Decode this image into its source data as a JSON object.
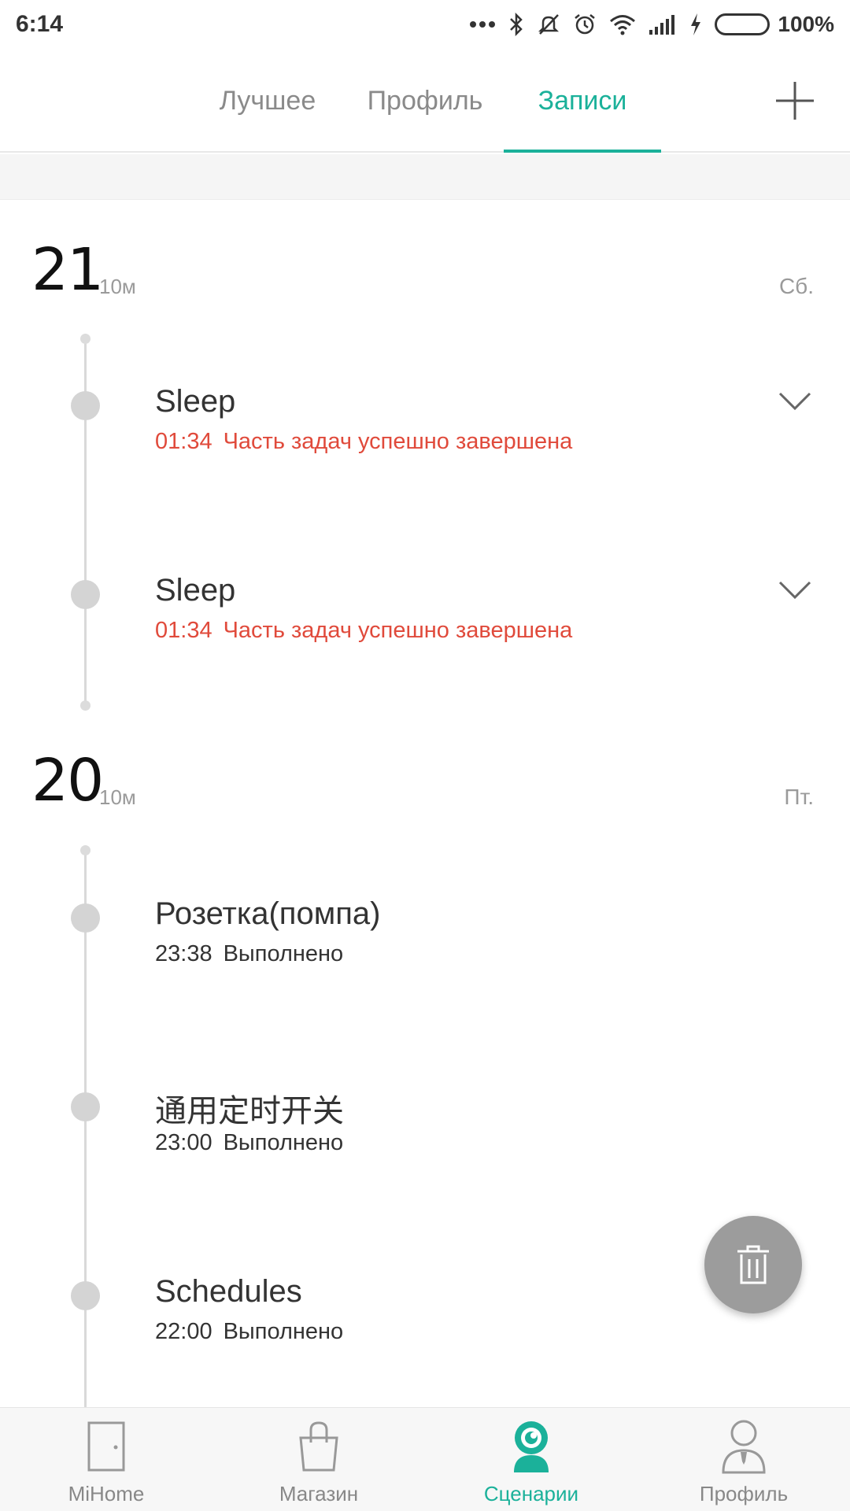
{
  "status_bar": {
    "time": "6:14",
    "battery_percent": "100%",
    "icons": [
      "more-dots-icon",
      "bluetooth-icon",
      "mute-icon",
      "alarm-icon",
      "wifi-icon",
      "signal-icon",
      "charging-icon",
      "battery-icon"
    ]
  },
  "tabs": {
    "items": [
      "Лучшее",
      "Профиль",
      "Записи"
    ],
    "active": "Записи",
    "add_icon": "plus-icon"
  },
  "colors": {
    "accent": "#1bb19a",
    "error": "#e04a3b",
    "fab": "#9c9c9c",
    "battery": "#2bbd2b"
  },
  "days": [
    {
      "day": "21",
      "month": "10м",
      "weekday": "Сб.",
      "entries": [
        {
          "title": "Sleep",
          "time": "01:34",
          "status": "Часть задач успешно завершена",
          "status_type": "partial",
          "expandable": true
        },
        {
          "title": "Sleep",
          "time": "01:34",
          "status": "Часть задач успешно завершена",
          "status_type": "partial",
          "expandable": true
        }
      ]
    },
    {
      "day": "20",
      "month": "10м",
      "weekday": "Пт.",
      "entries": [
        {
          "title": "Розетка(помпа)",
          "time": "23:38",
          "status": "Выполнено",
          "status_type": "done",
          "expandable": false
        },
        {
          "title": "通用定时开关",
          "time": "23:00",
          "status": "Выполнено",
          "status_type": "done",
          "expandable": false
        },
        {
          "title": "Schedules",
          "time": "22:00",
          "status": "Выполнено",
          "status_type": "done",
          "expandable": false
        }
      ]
    }
  ],
  "fab": {
    "icon": "trash-icon"
  },
  "bottom_nav": {
    "items": [
      {
        "label": "MiHome",
        "icon": "door-icon"
      },
      {
        "label": "Магазин",
        "icon": "shopping-bag-icon"
      },
      {
        "label": "Сценарии",
        "icon": "scenes-icon"
      },
      {
        "label": "Профиль",
        "icon": "profile-icon"
      }
    ],
    "active": "Сценарии"
  }
}
